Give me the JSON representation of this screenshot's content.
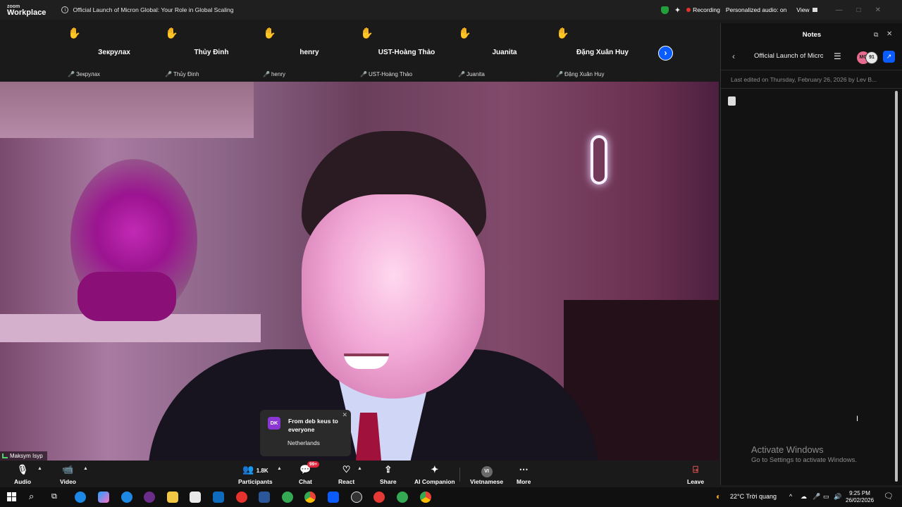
{
  "titlebar": {
    "brand_top": "zoom",
    "brand_bottom": "Workplace",
    "meeting_title": "Official Launch of Micron Global: Your Role in Global Scaling",
    "recording": "Recording",
    "personalized_audio": "Personalized audio: on",
    "view": "View"
  },
  "participants": [
    {
      "name": "Зекрулах",
      "sub": "Зекрулах"
    },
    {
      "name": "Thủy Đinh",
      "sub": "Thủy Đinh"
    },
    {
      "name": "henry",
      "sub": "henry"
    },
    {
      "name": "UST-Hoàng Thảo",
      "sub": "UST-Hoàng Thảo"
    },
    {
      "name": "Juanita",
      "sub": "Juanita"
    },
    {
      "name": "Đặng Xuân Huy",
      "sub": "Đặng Xuân Huy"
    }
  ],
  "speaker": {
    "name": "Maksym Isyp"
  },
  "chat_toast": {
    "initials": "DK",
    "from": "From deb keus to everyone",
    "message": "Netherlands"
  },
  "toolbar": {
    "audio": "Audio",
    "video": "Video",
    "participants": "Participants",
    "participant_count": "1.8K",
    "chat": "Chat",
    "chat_badge": "99+",
    "react": "React",
    "share": "Share",
    "ai_companion": "AI Companion",
    "language": "Vietnamese",
    "language_code": "VI",
    "more": "More",
    "leave": "Leave"
  },
  "notes": {
    "title": "Notes",
    "doc_title": "Official Launch of Micron Global: Your Role in Global Scaling",
    "avatar_initials": "MC",
    "avatar_count": "91",
    "last_edited": "Last edited on Thursday, February 26, 2026 by Lev B..."
  },
  "watermark": {
    "title": "Activate Windows",
    "subtitle": "Go to Settings to activate Windows."
  },
  "taskbar": {
    "weather": "22°C  Trời quang",
    "time": "9:25 PM",
    "date": "26/02/2026"
  },
  "colors": {
    "accent": "#0b5cff",
    "record_red": "#e5322d",
    "hand_yellow": "#f5c21b"
  }
}
